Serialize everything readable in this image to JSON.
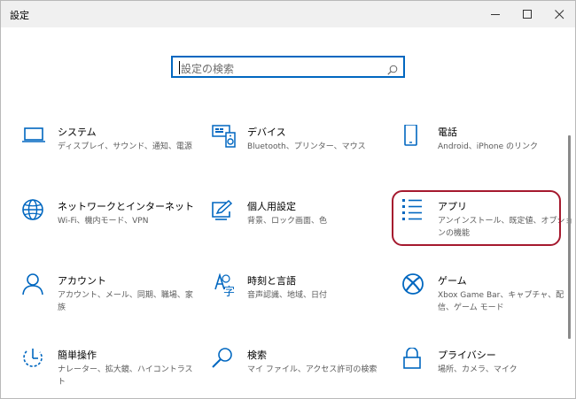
{
  "window": {
    "title": "設定",
    "minimize_icon": "minimize-icon",
    "maximize_icon": "maximize-icon",
    "close_icon": "close-icon"
  },
  "search": {
    "placeholder": "設定の検索",
    "icon": "search-icon"
  },
  "accent_color": "#0067c0",
  "highlight_color": "#a5192e",
  "items": [
    {
      "label": "システム",
      "desc": "ディスプレイ、サウンド、通知、電源",
      "icon": "laptop-icon"
    },
    {
      "label": "デバイス",
      "desc": "Bluetooth、プリンター、マウス",
      "icon": "devices-icon"
    },
    {
      "label": "電話",
      "desc": "Android、iPhone のリンク",
      "icon": "phone-icon"
    },
    {
      "label": "ネットワークとインターネット",
      "desc": "Wi-Fi、機内モード、VPN",
      "icon": "globe-icon"
    },
    {
      "label": "個人用設定",
      "desc": "背景、ロック画面、色",
      "icon": "personalization-icon"
    },
    {
      "label": "アプリ",
      "desc": "アンインストール、既定値、オプションの機能",
      "icon": "apps-list-icon"
    },
    {
      "label": "アカウント",
      "desc": "アカウント、メール、同期、職場、家族",
      "icon": "person-icon"
    },
    {
      "label": "時刻と言語",
      "desc": "音声認識、地域、日付",
      "icon": "time-language-icon"
    },
    {
      "label": "ゲーム",
      "desc": "Xbox Game Bar、キャプチャ、配信、ゲーム モード",
      "icon": "xbox-icon"
    },
    {
      "label": "簡単操作",
      "desc": "ナレーター、拡大鏡、ハイコントラスト",
      "icon": "ease-of-access-icon"
    },
    {
      "label": "検索",
      "desc": "マイ ファイル、アクセス許可の検索",
      "icon": "search-icon"
    },
    {
      "label": "プライバシー",
      "desc": "場所、カメラ、マイク",
      "icon": "lock-icon"
    }
  ]
}
